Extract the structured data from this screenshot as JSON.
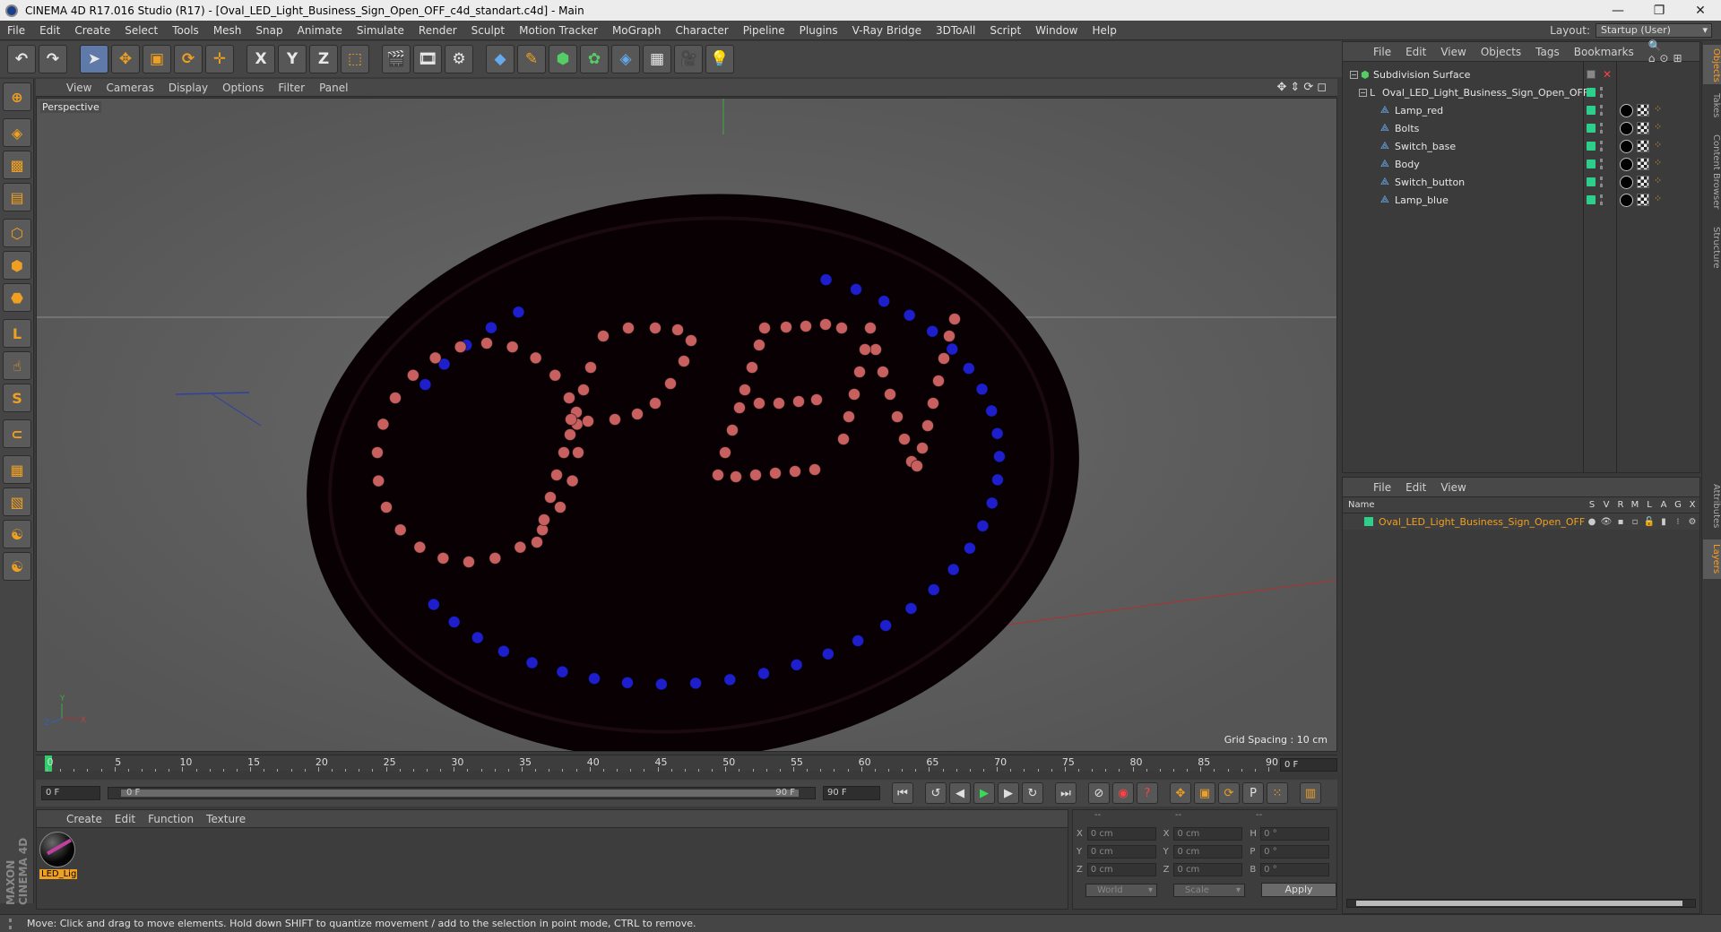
{
  "window": {
    "title": "CINEMA 4D R17.016 Studio (R17) - [Oval_LED_Light_Business_Sign_Open_OFF_c4d_standart.c4d] - Main",
    "minimize": "—",
    "maximize": "❐",
    "close": "✕"
  },
  "menubar": {
    "items": [
      "File",
      "Edit",
      "Create",
      "Select",
      "Tools",
      "Mesh",
      "Snap",
      "Animate",
      "Simulate",
      "Render",
      "Sculpt",
      "Motion Tracker",
      "MoGraph",
      "Character",
      "Pipeline",
      "Plugins",
      "V-Ray Bridge",
      "3DToAll",
      "Script",
      "Window",
      "Help"
    ],
    "layout_label": "Layout:",
    "layout_value": "Startup (User)"
  },
  "toolbar": {
    "undo": "↶",
    "redo": "↷",
    "axis_x": "X",
    "axis_y": "Y",
    "axis_z": "Z"
  },
  "viewport": {
    "menu": [
      "View",
      "Cameras",
      "Display",
      "Options",
      "Filter",
      "Panel"
    ],
    "camera_label": "Perspective",
    "grid_spacing": "Grid Spacing : 10 cm",
    "nav_icons": "✥⇕⟳◻"
  },
  "sign": {
    "text": "OPEN",
    "colors": {
      "body": "#0a0002",
      "lamp_red": "#c86060",
      "lamp_blue": "#1e1ecc"
    }
  },
  "timeline": {
    "ticks": [
      "0",
      "5",
      "10",
      "15",
      "20",
      "25",
      "30",
      "35",
      "40",
      "45",
      "50",
      "55",
      "60",
      "65",
      "70",
      "75",
      "80",
      "85",
      "90"
    ],
    "current_frame": "0 F"
  },
  "playbar": {
    "start": "0 F",
    "range_left": "0 F",
    "range_right": "90 F",
    "end": "90 F"
  },
  "material_manager": {
    "menu": [
      "Create",
      "Edit",
      "Function",
      "Texture"
    ],
    "material_label": "LED_Light"
  },
  "coordinates": {
    "headers": [
      "--",
      "--",
      "--"
    ],
    "rows": [
      {
        "a": "X",
        "av": "0 cm",
        "b": "X",
        "bv": "0 cm",
        "c": "H",
        "cv": "0 °"
      },
      {
        "a": "Y",
        "av": "0 cm",
        "b": "Y",
        "bv": "0 cm",
        "c": "P",
        "cv": "0 °"
      },
      {
        "a": "Z",
        "av": "0 cm",
        "b": "Z",
        "bv": "0 cm",
        "c": "B",
        "cv": "0 °"
      }
    ],
    "world": "World",
    "scale": "Scale",
    "apply": "Apply"
  },
  "object_manager": {
    "menu": [
      "File",
      "Edit",
      "View",
      "Objects",
      "Tags",
      "Bookmarks"
    ],
    "objects": [
      {
        "name": "Subdivision Surface",
        "level": 0
      },
      {
        "name": "Oval_LED_Light_Business_Sign_Open_OFF",
        "level": 1
      },
      {
        "name": "Lamp_red",
        "level": 2
      },
      {
        "name": "Bolts",
        "level": 2
      },
      {
        "name": "Switch_base",
        "level": 2
      },
      {
        "name": "Body",
        "level": 2
      },
      {
        "name": "Switch_button",
        "level": 2
      },
      {
        "name": "Lamp_blue",
        "level": 2
      }
    ]
  },
  "layer_manager": {
    "menu": [
      "File",
      "Edit",
      "View"
    ],
    "col_name": "Name",
    "cols": [
      "S",
      "V",
      "R",
      "M",
      "L",
      "A",
      "G",
      "X"
    ],
    "layer_name": "Oval_LED_Light_Business_Sign_Open_OFF"
  },
  "right_tabs": [
    "Objects",
    "Takes",
    "Content Browser",
    "Structure",
    "Attributes",
    "Layers"
  ],
  "branding": "MAXON CINEMA 4D",
  "status": "Move: Click and drag to move elements. Hold down SHIFT to quantize movement / add to the selection in point mode, CTRL to remove."
}
